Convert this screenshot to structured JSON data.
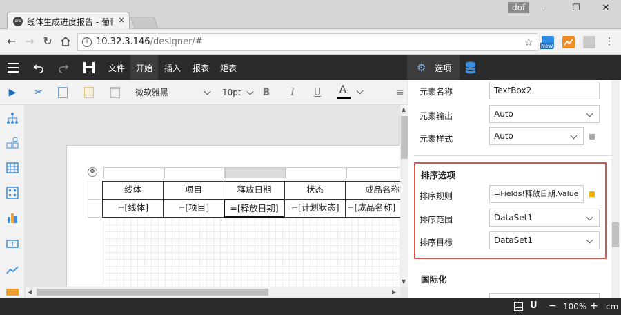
{
  "browser": {
    "tab_title": "线体生成进度报告 - 葡萄",
    "tab_close": "×",
    "favicon": "ars",
    "user": "dof",
    "url_host": "10.32.3.146",
    "url_path": "/designer/#",
    "ext_new_label": "New"
  },
  "window": {
    "minimize": "–",
    "maximize": "☐",
    "close": "✕"
  },
  "menu": {
    "file": "文件",
    "start": "开始",
    "insert": "插入",
    "report": "报表",
    "matrix": "矩表"
  },
  "toolbar": {
    "font_family": "微软雅黑",
    "font_size": "10pt",
    "bold": "B",
    "italic": "I",
    "underline": "U",
    "font_color_letter": "A",
    "font_color": "#000000"
  },
  "table": {
    "headers": [
      "线体",
      "项目",
      "释放日期",
      "状态",
      "成品名称"
    ],
    "cells": [
      "=[线体]",
      "=[项目]",
      "=[释放日期]",
      "=[计划状态]",
      "=[成品名称]"
    ]
  },
  "panel": {
    "tab_label": "选项",
    "element_name_label": "元素名称",
    "element_name_value": "TextBox2",
    "element_output_label": "元素输出",
    "element_output_value": "Auto",
    "element_style_label": "元素样式",
    "element_style_value": "Auto",
    "sort_section_title": "排序选项",
    "sort_rule_label": "排序规则",
    "sort_rule_value": "=Fields!释放日期.Value",
    "sort_scope_label": "排序范围",
    "sort_scope_value": "DataSet1",
    "sort_target_label": "排序目标",
    "sort_target_value": "DataSet1",
    "i18n_title": "国际化",
    "highlight_color": "#d9534f",
    "expr_marker_color": "#f0b400"
  },
  "status": {
    "zoom": "100%",
    "zoom_out": "−",
    "zoom_in": "+",
    "unit": "cm"
  }
}
